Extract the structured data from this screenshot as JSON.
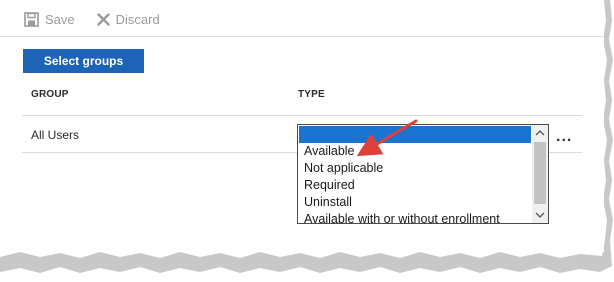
{
  "toolbar": {
    "save_label": "Save",
    "discard_label": "Discard"
  },
  "select_groups_label": "Select groups",
  "table": {
    "columns": [
      "GROUP",
      "TYPE"
    ],
    "rows": [
      {
        "group": "All Users",
        "type": ""
      }
    ]
  },
  "type_dropdown": {
    "options": [
      "",
      "Available",
      "Not applicable",
      "Required",
      "Uninstall",
      "Available with or without enrollment"
    ],
    "selected_index": 0
  },
  "more_label": "...",
  "annotation": {
    "arrow_color": "#e0403a",
    "points_to": "Available"
  },
  "colors": {
    "accent": "#1d64b6",
    "selection": "#1a74d1"
  }
}
